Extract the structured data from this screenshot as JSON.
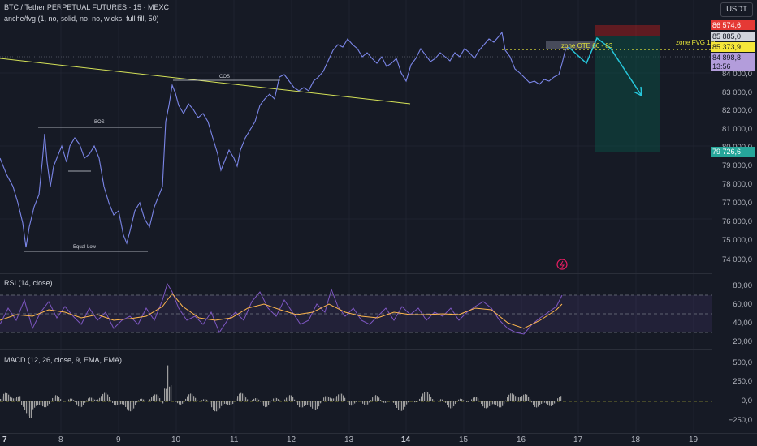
{
  "header": {
    "title": "BTC / Tether PERPETUAL FUTURES · 15 · MEXC",
    "indicator": "anche/fvg (1, no, solid, no, no, wicks, full fill, 50)",
    "currency_button": "USDT"
  },
  "annotations": {
    "bos": "BOS",
    "cos": "COS",
    "equal_low": "Equal Low",
    "zone_ote": "zone OTE 66 - 83",
    "zone_fvg": "zone FVG 1H"
  },
  "price_axis": [
    "84 000,0",
    "83 000,0",
    "82 000,0",
    "81 000,0",
    "80 000,0",
    "79 000,0",
    "78 000,0",
    "77 000,0",
    "76 000,0",
    "75 000,0",
    "74 000,0"
  ],
  "price_tags": {
    "stop": "86 574,6",
    "fvg": "85 885,0",
    "ote": "85 373,9",
    "last": "84 898,8",
    "countdown": "13:56",
    "target": "79 726,6"
  },
  "rsi": {
    "label": "RSI (14, close)",
    "axis": [
      "80,00",
      "60,00",
      "40,00",
      "20,00"
    ]
  },
  "macd": {
    "label": "MACD (12, 26, close, 9, EMA, EMA)",
    "axis": [
      "500,0",
      "250,0",
      "0,0",
      "−250,0"
    ]
  },
  "time_axis": [
    "7",
    "8",
    "9",
    "10",
    "11",
    "12",
    "13",
    "14",
    "15",
    "16",
    "17",
    "18",
    "19"
  ],
  "colors": {
    "background": "#161a25",
    "price_line": "#7b86e8",
    "trendline": "#d4e157",
    "projection": "#26c6da",
    "stop_zone": "#b71c1c",
    "target_zone": "#0d4d44",
    "rsi_line": "#7e57c2",
    "rsi_ma": "#ffb74d",
    "macd_hist": "#9e9e9e"
  },
  "chart_data": {
    "type": "line",
    "x": [
      "7",
      "8",
      "9",
      "10",
      "11",
      "12",
      "13",
      "14",
      "15",
      "16",
      "16.7"
    ],
    "values": [
      78000,
      79000,
      76500,
      83600,
      79500,
      83500,
      85200,
      84200,
      85500,
      84000,
      85000
    ],
    "ylim": [
      73500,
      86800
    ]
  }
}
